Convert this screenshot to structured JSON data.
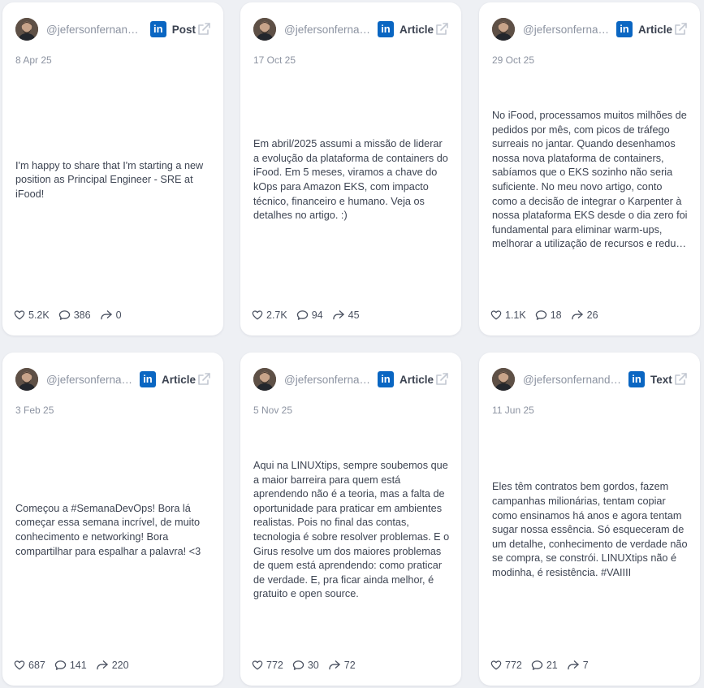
{
  "colors": {
    "page_background": "#eef0f4",
    "card_background": "#ffffff",
    "linkedin_blue": "#0a66c2",
    "muted_text": "#8c93a1",
    "body_text": "#3d4452"
  },
  "icons": {
    "platform": "linkedin-icon",
    "open_external": "external-link-icon",
    "likes": "heart-icon",
    "comments": "comment-icon",
    "shares": "share-icon"
  },
  "cards": [
    {
      "handle": "@jefersonfernandodasilva",
      "type": "Post",
      "date": "8 Apr 25",
      "text": "I'm happy to share that I'm starting a new position as Principal Engineer - SRE at iFood!",
      "likes": "5.2K",
      "comments": "386",
      "shares": "0"
    },
    {
      "handle": "@jefersonfernandodasilva",
      "type": "Article",
      "date": "17 Oct 25",
      "text": "Em abril/2025 assumi a missão de liderar a evolução da plataforma de containers do iFood. Em 5 meses, viramos a chave do kOps para Amazon EKS, com impacto técnico, financeiro e humano. Veja os detalhes no artigo. :)",
      "likes": "2.7K",
      "comments": "94",
      "shares": "45"
    },
    {
      "handle": "@jefersonfernandodasilva",
      "type": "Article",
      "date": "29 Oct 25",
      "text": "No iFood, processamos muitos milhões de pedidos por mês, com picos de tráfego surreais no jantar. Quando desenhamos nossa nova plataforma de containers, sabíamos que o EKS sozinho não seria suficiente. No meu novo artigo, conto como a decisão de integrar o Karpenter à nossa plataforma EKS desde o dia zero foi fundamental para eliminar warm-ups, melhorar a utilização de recursos e reduzir custos.",
      "likes": "1.1K",
      "comments": "18",
      "shares": "26"
    },
    {
      "handle": "@jefersonfernandodasilva",
      "type": "Article",
      "date": "3 Feb 25",
      "text": "Começou a #SemanaDevOps! Bora lá começar essa semana incrível, de muito conhecimento e networking! Bora compartilhar para espalhar a palavra! <3",
      "likes": "687",
      "comments": "141",
      "shares": "220"
    },
    {
      "handle": "@jefersonfernandodasilva",
      "type": "Article",
      "date": "5 Nov 25",
      "text": "Aqui na LINUXtips, sempre soubemos que a maior barreira para quem está aprendendo não é a teoria, mas a falta de oportunidade para praticar em ambientes realistas. Pois no final das contas, tecnologia é sobre resolver problemas. E o Girus resolve um dos maiores problemas de quem está aprendendo: como praticar de verdade. E, pra ficar ainda melhor, é gratuito e open source.",
      "likes": "772",
      "comments": "30",
      "shares": "72"
    },
    {
      "handle": "@jefersonfernandodasilva",
      "type": "Text",
      "date": "11 Jun 25",
      "text": "Eles têm contratos bem gordos, fazem campanhas milionárias, tentam copiar como ensinamos há anos e agora tentam sugar nossa essência. Só esqueceram de um detalhe, conhecimento de verdade não se compra, se constrói. LINUXtips não é modinha, é resistência. #VAIIII",
      "likes": "772",
      "comments": "21",
      "shares": "7"
    }
  ]
}
